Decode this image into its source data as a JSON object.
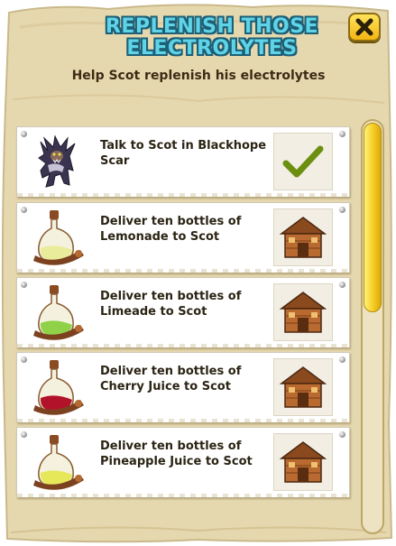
{
  "dialog": {
    "title_line1": "REPLENISH THOSE",
    "title_line2": "ELECTROLYTES",
    "subtitle": "Help Scot replenish his electrolytes"
  },
  "tasks": [
    {
      "text": "Talk to Scot in Blackhope Scar",
      "icon": "werewolf-icon",
      "status": "checkmark-icon"
    },
    {
      "text": "Deliver ten bottles of Lemonade to Scot",
      "icon": "lemonade-bottle-icon",
      "status": "building-icon"
    },
    {
      "text": "Deliver ten bottles of Limeade to Scot",
      "icon": "limeade-bottle-icon",
      "status": "building-icon"
    },
    {
      "text": "Deliver ten bottles of Cherry Juice to Scot",
      "icon": "cherry-juice-bottle-icon",
      "status": "building-icon"
    },
    {
      "text": "Deliver ten bottles of Pineapple Juice to Scot",
      "icon": "pineapple-juice-bottle-icon",
      "status": "building-icon"
    }
  ],
  "colors": {
    "parchment": "#e9dcb4",
    "title": "#5fd4e6",
    "title_outline": "#1d5f77",
    "check": "#6c8f10",
    "close_button": "#f7c823",
    "lemonade": "#e9ec9a",
    "limeade": "#8fd24a",
    "cherry_juice": "#b3122b",
    "pineapple_juice": "#e6e85a"
  }
}
